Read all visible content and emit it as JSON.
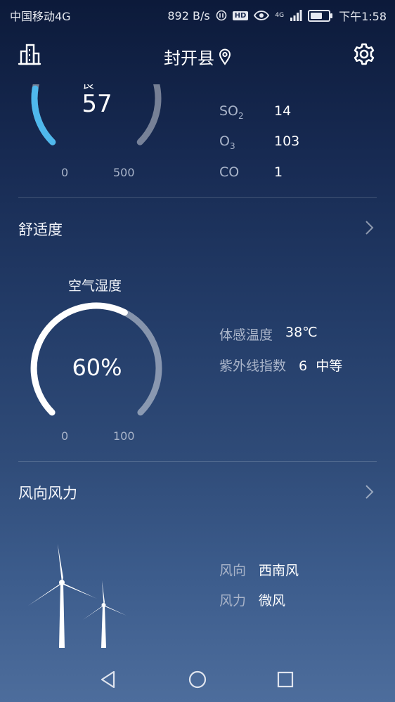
{
  "status_bar": {
    "carrier": "中国移动4G",
    "speed": "892 B/s",
    "hd_badge": "HD",
    "network": "4G",
    "time": "下午1:58"
  },
  "header": {
    "city": "封开县"
  },
  "aqi": {
    "label_partial": "良",
    "value": "57",
    "min": "0",
    "max": "500",
    "level": 57,
    "scale_max": 500,
    "arc_color": "#4fb8ec",
    "pollutants": [
      {
        "name_main": "SO",
        "name_sub": "2",
        "value": "14"
      },
      {
        "name_main": "O",
        "name_sub": "3",
        "value": "103"
      },
      {
        "name_main": "CO",
        "name_sub": "",
        "value": "1"
      }
    ]
  },
  "comfort": {
    "title": "舒适度",
    "humidity_label": "空气湿度",
    "humidity_value": "60%",
    "humidity_level": 60,
    "min": "0",
    "max": "100",
    "feels_like_label": "体感温度",
    "feels_like_value": "38℃",
    "uv_label": "紫外线指数",
    "uv_value": "6",
    "uv_level": "中等"
  },
  "wind": {
    "title": "风向风力",
    "direction_label": "风向",
    "direction_value": "西南风",
    "force_label": "风力",
    "force_value": "微风"
  },
  "colors": {
    "arc_track": "rgba(255,255,255,0.45)",
    "arc_fill_white": "#ffffff"
  },
  "icons": {
    "left": "building-icon",
    "location": "location-pin-icon",
    "settings": "gear-icon"
  }
}
